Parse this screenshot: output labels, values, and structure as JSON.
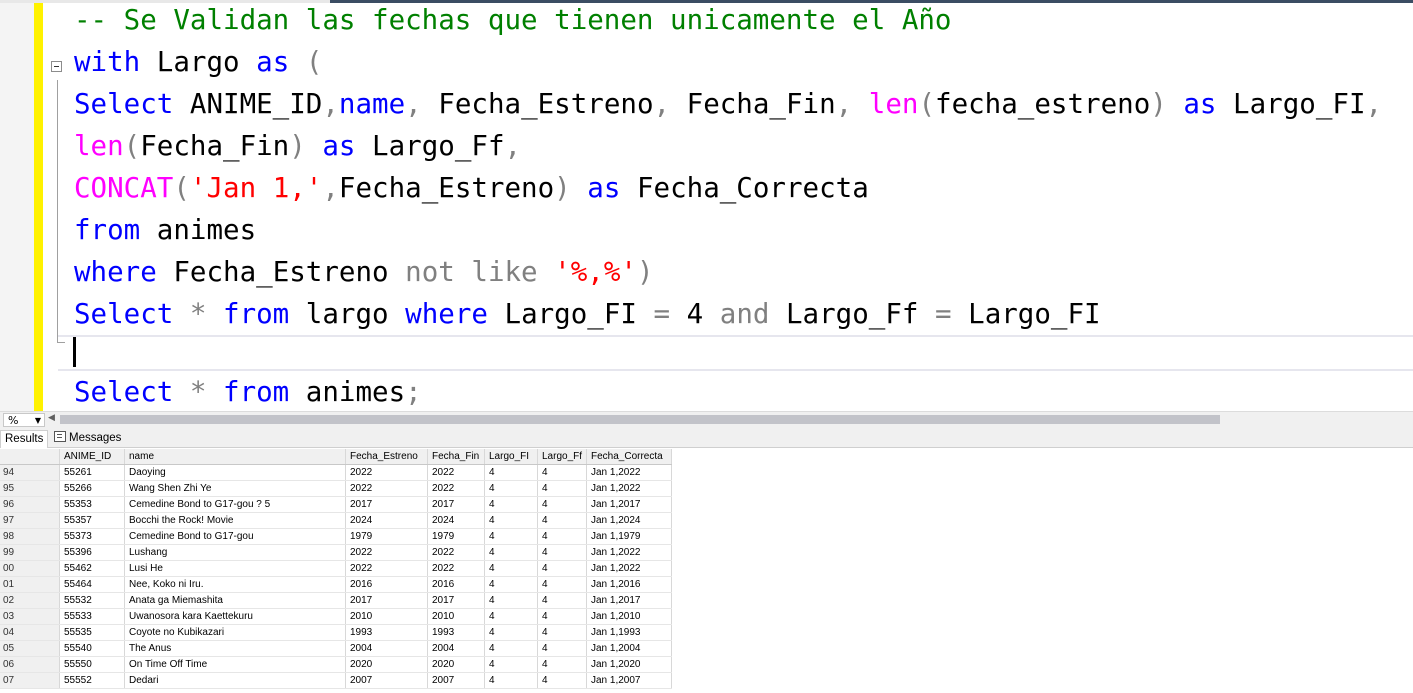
{
  "editor": {
    "lines": [
      {
        "tokens": [
          {
            "t": "-- Se Validan las fechas que tienen unicamente el Año",
            "c": "cm"
          }
        ]
      },
      {
        "tokens": [
          {
            "t": "with",
            "c": "kw"
          },
          {
            "t": " Largo ",
            "c": ""
          },
          {
            "t": "as",
            "c": "kw"
          },
          {
            "t": " (",
            "c": "gr"
          }
        ]
      },
      {
        "tokens": [
          {
            "t": "Select",
            "c": "kw"
          },
          {
            "t": " ANIME_ID",
            "c": ""
          },
          {
            "t": ",",
            "c": "gr"
          },
          {
            "t": "name",
            "c": "kw"
          },
          {
            "t": ", ",
            "c": "gr"
          },
          {
            "t": "Fecha_Estreno",
            "c": ""
          },
          {
            "t": ", ",
            "c": "gr"
          },
          {
            "t": "Fecha_Fin",
            "c": ""
          },
          {
            "t": ", ",
            "c": "gr"
          },
          {
            "t": "len",
            "c": "fn"
          },
          {
            "t": "(",
            "c": "gr"
          },
          {
            "t": "fecha_estreno",
            "c": ""
          },
          {
            "t": ") ",
            "c": "gr"
          },
          {
            "t": "as",
            "c": "kw"
          },
          {
            "t": " Largo_FI",
            "c": ""
          },
          {
            "t": ",",
            "c": "gr"
          }
        ]
      },
      {
        "tokens": [
          {
            "t": "len",
            "c": "fn"
          },
          {
            "t": "(",
            "c": "gr"
          },
          {
            "t": "Fecha_Fin",
            "c": ""
          },
          {
            "t": ") ",
            "c": "gr"
          },
          {
            "t": "as",
            "c": "kw"
          },
          {
            "t": " Largo_Ff",
            "c": ""
          },
          {
            "t": ",",
            "c": "gr"
          }
        ]
      },
      {
        "tokens": [
          {
            "t": "CONCAT",
            "c": "fn"
          },
          {
            "t": "(",
            "c": "gr"
          },
          {
            "t": "'Jan 1,'",
            "c": "str"
          },
          {
            "t": ",",
            "c": "gr"
          },
          {
            "t": "Fecha_Estreno",
            "c": ""
          },
          {
            "t": ") ",
            "c": "gr"
          },
          {
            "t": "as",
            "c": "kw"
          },
          {
            "t": " Fecha_Correcta",
            "c": ""
          }
        ]
      },
      {
        "tokens": [
          {
            "t": "from",
            "c": "kw"
          },
          {
            "t": " animes",
            "c": ""
          }
        ]
      },
      {
        "tokens": [
          {
            "t": "where",
            "c": "kw"
          },
          {
            "t": " Fecha_Estreno ",
            "c": ""
          },
          {
            "t": "not like",
            "c": "gr"
          },
          {
            "t": " ",
            "c": ""
          },
          {
            "t": "'%,%'",
            "c": "str"
          },
          {
            "t": ")",
            "c": "gr"
          }
        ]
      },
      {
        "tokens": [
          {
            "t": "Select",
            "c": "kw"
          },
          {
            "t": " * ",
            "c": "gr"
          },
          {
            "t": "from",
            "c": "kw"
          },
          {
            "t": " largo ",
            "c": ""
          },
          {
            "t": "where",
            "c": "kw"
          },
          {
            "t": " Largo_FI ",
            "c": ""
          },
          {
            "t": "=",
            "c": "gr"
          },
          {
            "t": " 4 ",
            "c": ""
          },
          {
            "t": "and",
            "c": "gr"
          },
          {
            "t": " Largo_Ff ",
            "c": ""
          },
          {
            "t": "=",
            "c": "gr"
          },
          {
            "t": " Largo_FI",
            "c": ""
          }
        ]
      },
      {
        "tokens": []
      },
      {
        "tokens": [
          {
            "t": "Select",
            "c": "kw"
          },
          {
            "t": " * ",
            "c": "gr"
          },
          {
            "t": "from",
            "c": "kw"
          },
          {
            "t": " animes",
            "c": ""
          },
          {
            "t": ";",
            "c": "gr"
          }
        ]
      }
    ]
  },
  "zoom": {
    "value": "%"
  },
  "tabs": {
    "results": "Results",
    "messages": "Messages"
  },
  "grid": {
    "columns": [
      "ANIME_ID",
      "name",
      "Fecha_Estreno",
      "Fecha_Fin",
      "Largo_FI",
      "Largo_Ff",
      "Fecha_Correcta"
    ],
    "rows": [
      {
        "n": "94",
        "cells": [
          "55261",
          "Daoying",
          "2022",
          "2022",
          "4",
          "4",
          "Jan 1,2022"
        ]
      },
      {
        "n": "95",
        "cells": [
          "55266",
          "Wang Shen Zhi Ye",
          "2022",
          "2022",
          "4",
          "4",
          "Jan 1,2022"
        ]
      },
      {
        "n": "96",
        "cells": [
          "55353",
          "Cemedine Bond to G17-gou ? 5",
          "2017",
          "2017",
          "4",
          "4",
          "Jan 1,2017"
        ]
      },
      {
        "n": "97",
        "cells": [
          "55357",
          "Bocchi the Rock! Movie",
          "2024",
          "2024",
          "4",
          "4",
          "Jan 1,2024"
        ]
      },
      {
        "n": "98",
        "cells": [
          "55373",
          "Cemedine Bond to G17-gou",
          "1979",
          "1979",
          "4",
          "4",
          "Jan 1,1979"
        ]
      },
      {
        "n": "99",
        "cells": [
          "55396",
          "Lushang",
          "2022",
          "2022",
          "4",
          "4",
          "Jan 1,2022"
        ]
      },
      {
        "n": "00",
        "cells": [
          "55462",
          "Lusi He",
          "2022",
          "2022",
          "4",
          "4",
          "Jan 1,2022"
        ]
      },
      {
        "n": "01",
        "cells": [
          "55464",
          "Nee, Koko ni Iru.",
          "2016",
          "2016",
          "4",
          "4",
          "Jan 1,2016"
        ]
      },
      {
        "n": "02",
        "cells": [
          "55532",
          "Anata ga Miemashita",
          "2017",
          "2017",
          "4",
          "4",
          "Jan 1,2017"
        ]
      },
      {
        "n": "03",
        "cells": [
          "55533",
          "Uwanosora kara Kaettekuru",
          "2010",
          "2010",
          "4",
          "4",
          "Jan 1,2010"
        ]
      },
      {
        "n": "04",
        "cells": [
          "55535",
          "Coyote no Kubikazari",
          "1993",
          "1993",
          "4",
          "4",
          "Jan 1,1993"
        ]
      },
      {
        "n": "05",
        "cells": [
          "55540",
          "The Anus",
          "2004",
          "2004",
          "4",
          "4",
          "Jan 1,2004"
        ]
      },
      {
        "n": "06",
        "cells": [
          "55550",
          "On Time Off Time",
          "2020",
          "2020",
          "4",
          "4",
          "Jan 1,2020"
        ]
      },
      {
        "n": "07",
        "cells": [
          "55552",
          "Dedari",
          "2007",
          "2007",
          "4",
          "4",
          "Jan 1,2007"
        ]
      }
    ]
  }
}
